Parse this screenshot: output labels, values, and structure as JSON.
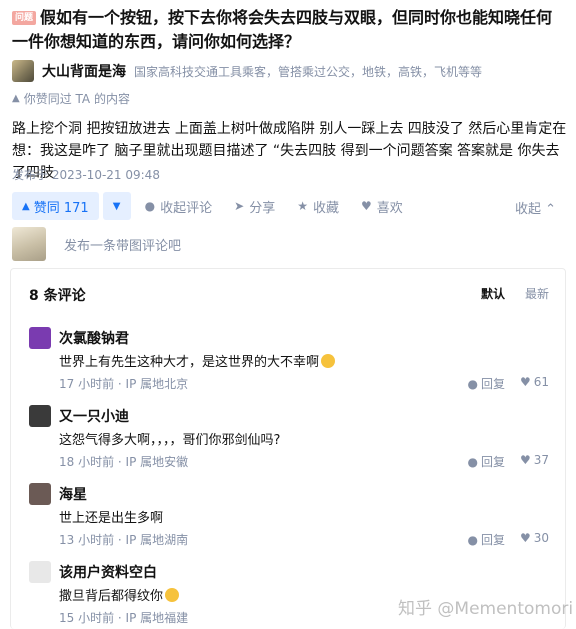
{
  "question": {
    "badge": "问题",
    "title": "假如有一个按钮，按下去你将会失去四肢与双眼，但同时你也能知晓任何一件你想知道的东西，请问你如何选择？"
  },
  "author": {
    "name": "大山背面是海",
    "bio": "国家高科技交通工具乘客，管搭乘过公交，地铁，高铁，飞机等等"
  },
  "upvoted_note": "你赞同过 TA 的内容",
  "answer": {
    "text": "路上挖个洞 把按钮放进去 上面盖上树叶做成陷阱 别人一踩上去 四肢没了 然后心里肯定在想：我这是咋了 脑子里就出现题目描述了 “失去四肢 得到一个问题答案 答案就是 你失去了四肢",
    "date": "发布于 2023-10-21 09:48"
  },
  "actions": {
    "upvote_label": "赞同 171",
    "downvote_symbol": "▼",
    "collapse_comments": "收起评论",
    "share": "分享",
    "favorite": "收藏",
    "like": "喜欢",
    "collapse": "收起 ⌃"
  },
  "comment_input": {
    "placeholder": "发布一条带图评论吧"
  },
  "comments": {
    "count_label": "8 条评论",
    "sort_default": "默认",
    "sort_latest": "最新",
    "reply_label": "回复",
    "items": [
      {
        "name": "次氯酸钠君",
        "text": "世界上有先生这种大才，是这世界的大不幸啊",
        "meta": "17 小时前 · IP 属地北京",
        "likes": "61",
        "avatar_color": "#7a3bb0"
      },
      {
        "name": "又一只小迪",
        "text": "这怨气得多大啊，，，，哥们你邪剑仙吗?",
        "meta": "18 小时前 · IP 属地安徽",
        "likes": "37",
        "avatar_color": "#3a3a3a"
      },
      {
        "name": "海星",
        "text": "世上还是出生多啊",
        "meta": "13 小时前 · IP 属地湖南",
        "likes": "30",
        "avatar_color": "#6b5a55"
      },
      {
        "name": "该用户资料空白",
        "text": "撒旦背后都得纹你",
        "meta": "15 小时前 · IP 属地福建",
        "likes": "",
        "avatar_color": "#e8e8e8"
      }
    ]
  },
  "watermark": "知乎 @Mementomori"
}
